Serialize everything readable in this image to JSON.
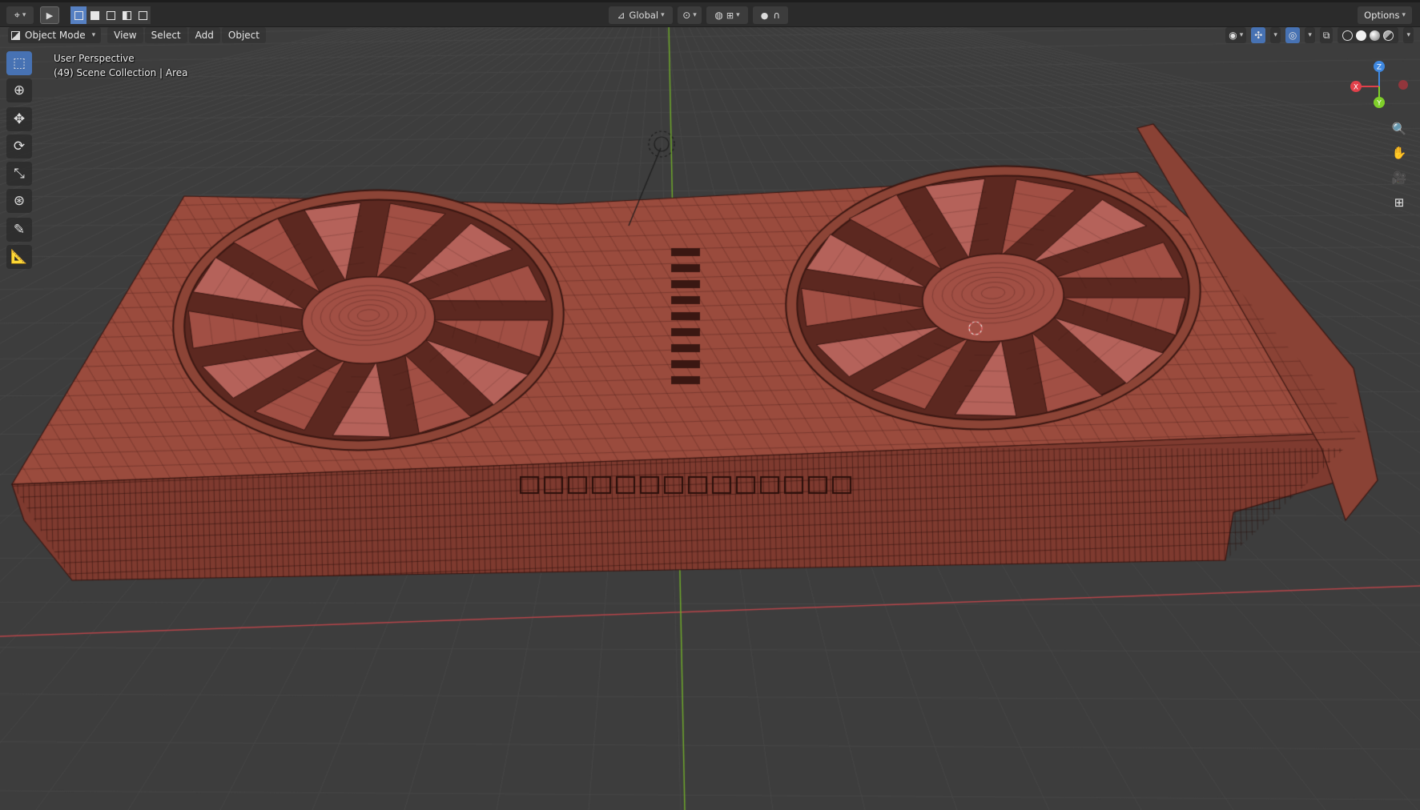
{
  "header": {
    "editor_type_icon": "viewport-editor-icon",
    "transform_orientation": "Global",
    "options_label": "Options"
  },
  "menubar": {
    "mode": "Object Mode",
    "items": [
      "View",
      "Select",
      "Add",
      "Object"
    ]
  },
  "overlay": {
    "view_name": "User Perspective",
    "collection_info": "(49) Scene Collection | Area"
  },
  "gizmo": {
    "axes": [
      "X",
      "Y",
      "Z"
    ],
    "colors": {
      "x": "#e0404a",
      "y": "#7fcf2a",
      "z": "#3f88e0"
    }
  },
  "toolbar_icons": [
    "select-box-icon",
    "cursor-icon",
    "move-icon",
    "rotate-icon",
    "scale-icon",
    "transform-icon",
    "annotate-icon",
    "measure-icon"
  ],
  "navigation_icons": [
    "zoom-icon",
    "pan-hand-icon",
    "camera-view-icon",
    "ortho-grid-icon"
  ],
  "colors": {
    "viewport_bg": "#3d3d3d",
    "grid_line": "#474747",
    "model_fill": "#9a4b3d",
    "model_wire": "#3a1712",
    "x_axis_line": "#b8454a",
    "y_axis_line": "#6fa82c",
    "select_active": "#4772b3"
  },
  "scene": {
    "object": "graphics card with two cooling fans",
    "shading": "solid + wireframe overlay"
  }
}
